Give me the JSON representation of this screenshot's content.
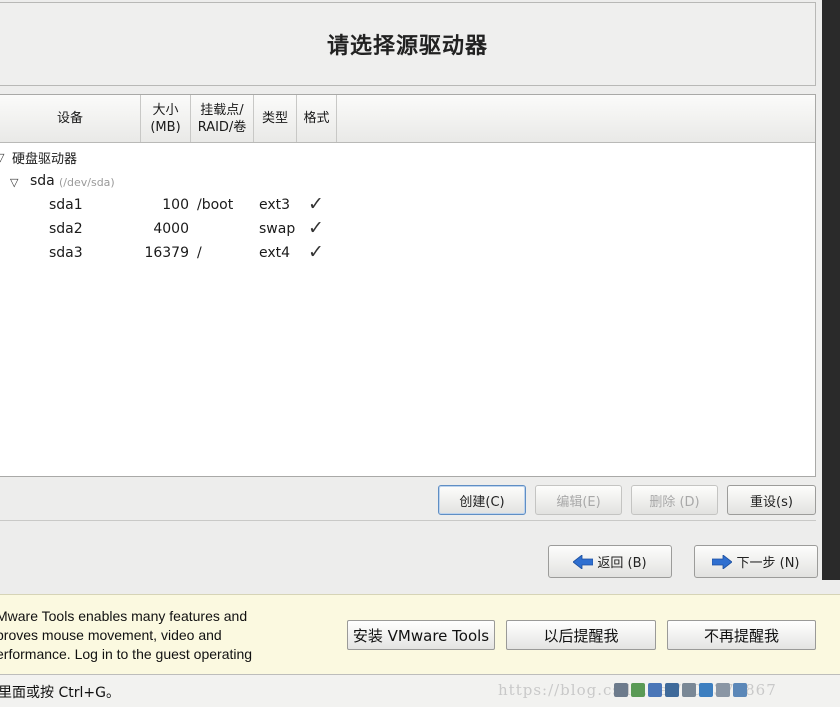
{
  "window": {
    "title": "请选择源驱动器"
  },
  "table": {
    "headers": {
      "device": "设备",
      "size_line1": "大小",
      "size_line2": "(MB)",
      "mount_line1": "挂载点/",
      "mount_line2": "RAID/卷",
      "type": "类型",
      "format": "格式"
    },
    "group": {
      "label": "硬盘驱动器"
    },
    "disk": {
      "name": "sda",
      "path": "(/dev/sda)"
    },
    "partitions": [
      {
        "name": "sda1",
        "size": "100",
        "mount": "/boot",
        "type": "ext3",
        "format": "✓"
      },
      {
        "name": "sda2",
        "size": "4000",
        "mount": "",
        "type": "swap",
        "format": "✓"
      },
      {
        "name": "sda3",
        "size": "16379",
        "mount": "/",
        "type": "ext4",
        "format": "✓"
      }
    ]
  },
  "actions": {
    "create": "创建(C)",
    "edit": "编辑(E)",
    "delete": "删除 (D)",
    "reset": "重设(s)"
  },
  "nav": {
    "back": "返回 (B)",
    "next": "下一步 (N)"
  },
  "vmware": {
    "message": "Mware Tools enables many features and\nproves mouse movement, video and\nerformance. Log in to the guest operating",
    "install": "安装 VMware Tools",
    "remind_later": "以后提醒我",
    "never_remind": "不再提醒我"
  },
  "status": {
    "text": "里面或按 Ctrl+G。",
    "watermark": "https://blog.csdn.net/u01378867"
  },
  "colors": {
    "accent_arrow": "#2f6fd0",
    "focus_border": "#5f8ec4",
    "vm_bar_bg": "#fbf9e0"
  }
}
